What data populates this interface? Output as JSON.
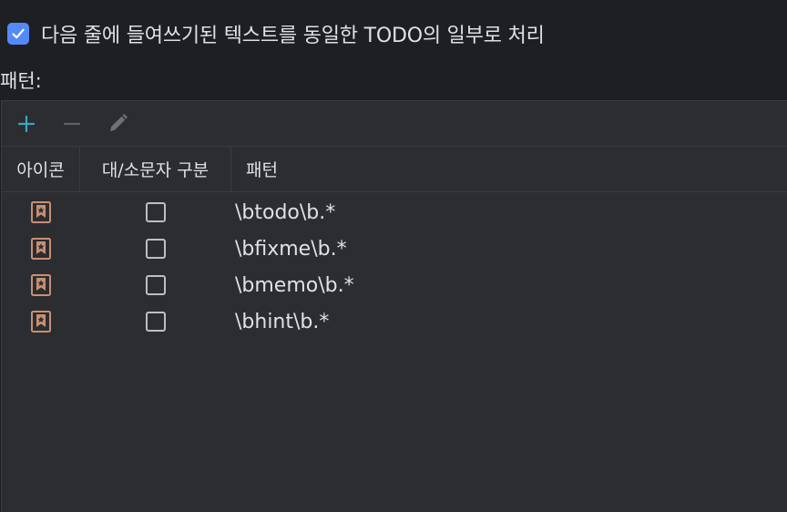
{
  "option": {
    "label": "다음 줄에 들여쓰기된 텍스트를 동일한 TODO의 일부로 처리",
    "checked": true
  },
  "patterns_label": "패턴:",
  "toolbar": {
    "add_icon": "plus-icon",
    "remove_icon": "minus-icon",
    "edit_icon": "pencil-icon"
  },
  "table": {
    "columns": [
      "아이콘",
      "대/소문자 구분",
      "패턴"
    ],
    "rows": [
      {
        "icon": "todo-bookmark-icon",
        "case_sensitive": false,
        "pattern": "\\btodo\\b.*"
      },
      {
        "icon": "todo-bookmark-icon",
        "case_sensitive": false,
        "pattern": "\\bfixme\\b.*"
      },
      {
        "icon": "todo-bookmark-icon",
        "case_sensitive": false,
        "pattern": "\\bmemo\\b.*"
      },
      {
        "icon": "todo-bookmark-icon",
        "case_sensitive": false,
        "pattern": "\\bhint\\b.*"
      }
    ]
  },
  "colors": {
    "background": "#1e1f22",
    "panel": "#2b2d30",
    "accent": "#548af7",
    "add_icon": "#3aa7c4",
    "todo_icon": "#c98f73"
  }
}
